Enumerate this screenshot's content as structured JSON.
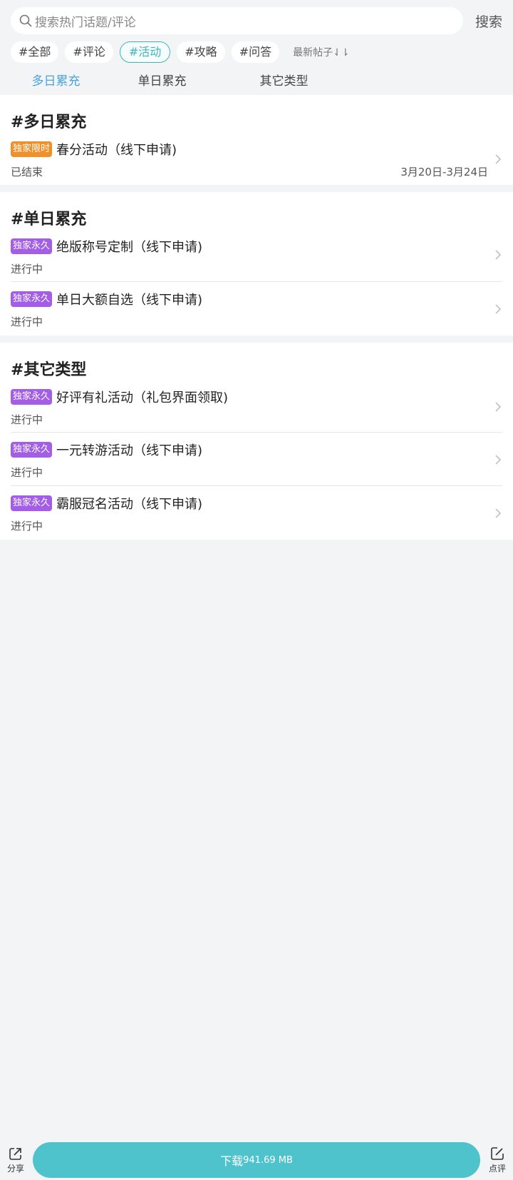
{
  "search": {
    "placeholder": "搜索热门话题/评论",
    "button_label": "搜索"
  },
  "tags": [
    {
      "label": "#全部",
      "active": false
    },
    {
      "label": "#评论",
      "active": false
    },
    {
      "label": "#活动",
      "active": true
    },
    {
      "label": "#攻略",
      "active": false
    },
    {
      "label": "#问答",
      "active": false
    }
  ],
  "sort_label": "最新帖子⇃⇂",
  "subtabs": [
    "多日累充",
    "单日累充",
    "其它类型"
  ],
  "active_subtab": "多日累充",
  "colors": {
    "accent": "#3fb5bf",
    "tab_active": "#4ba3e0",
    "badge_orange": "#f0902a",
    "badge_purple": "#a35de6",
    "download": "#4fc3cb"
  },
  "sections": [
    {
      "title": "#多日累充",
      "items": [
        {
          "badge": "独家限时",
          "badge_color": "#f0902a",
          "title": "春分活动（线下申请)",
          "status": "已结束",
          "date": "3月20日-3月24日"
        }
      ]
    },
    {
      "title": "#单日累充",
      "items": [
        {
          "badge": "独家永久",
          "badge_color": "#a35de6",
          "title": "绝版称号定制（线下申请)",
          "status": "进行中",
          "date": ""
        },
        {
          "badge": "独家永久",
          "badge_color": "#a35de6",
          "title": "单日大额自选（线下申请)",
          "status": "进行中",
          "date": ""
        }
      ]
    },
    {
      "title": "#其它类型",
      "items": [
        {
          "badge": "独家永久",
          "badge_color": "#a35de6",
          "title": "好评有礼活动（礼包界面领取)",
          "status": "进行中",
          "date": ""
        },
        {
          "badge": "独家永久",
          "badge_color": "#a35de6",
          "title": "一元转游活动（线下申请)",
          "status": "进行中",
          "date": ""
        },
        {
          "badge": "独家永久",
          "badge_color": "#a35de6",
          "title": "霸服冠名活动（线下申请)",
          "status": "进行中",
          "date": ""
        }
      ]
    }
  ],
  "bottom": {
    "share_label": "分享",
    "download_label": "下载",
    "download_size": "941.69 MB",
    "review_label": "点评"
  }
}
